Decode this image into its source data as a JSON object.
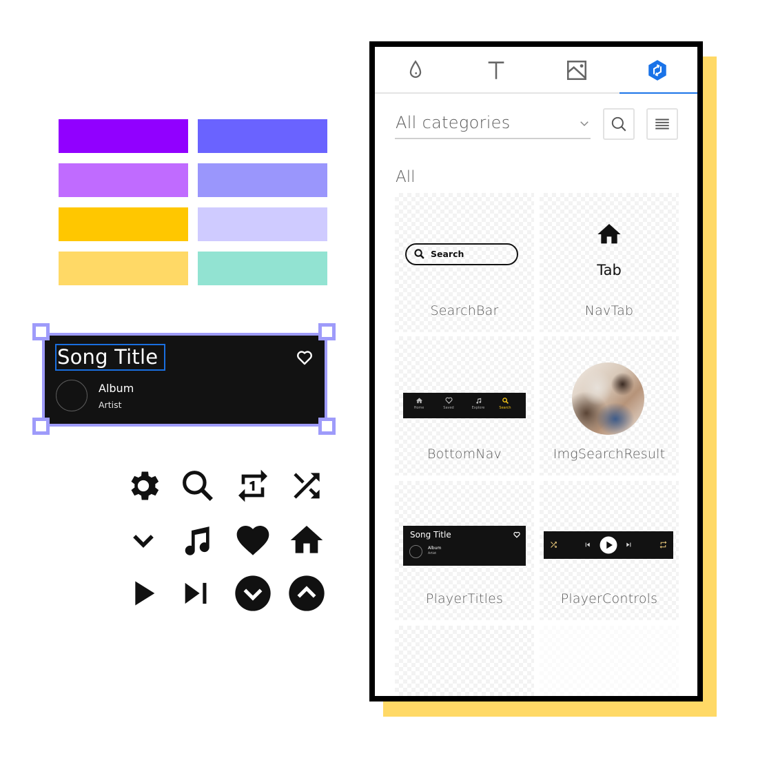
{
  "palette": {
    "swatches": [
      {
        "name": "purple",
        "color": "#9100ff"
      },
      {
        "name": "indigo",
        "color": "#6a63ff"
      },
      {
        "name": "light-purple",
        "color": "#c06bff"
      },
      {
        "name": "light-indigo",
        "color": "#9a96fc"
      },
      {
        "name": "amber",
        "color": "#ffc700"
      },
      {
        "name": "lavender",
        "color": "#cfcbff"
      },
      {
        "name": "light-amber",
        "color": "#ffd966"
      },
      {
        "name": "mint",
        "color": "#92e3d2"
      }
    ]
  },
  "selected_component": {
    "song_title": "Song Title",
    "album": "Album",
    "artist": "Artist",
    "selection_color": "#9e9bfa",
    "text_box_color": "#1a6fe0"
  },
  "icon_set": [
    "settings-icon",
    "search-icon",
    "repeat-one-icon",
    "shuffle-icon",
    "chevron-down-icon",
    "music-note-icon",
    "heart-icon",
    "home-icon",
    "play-icon",
    "skip-next-icon",
    "expand-circle-down-icon",
    "expand-circle-up-icon"
  ],
  "panel": {
    "tabs": [
      {
        "name": "style",
        "icon": "drop-icon",
        "active": false
      },
      {
        "name": "text",
        "icon": "text-icon",
        "active": false
      },
      {
        "name": "images",
        "icon": "image-icon",
        "active": false
      },
      {
        "name": "components",
        "icon": "components-icon",
        "active": true
      }
    ],
    "accent_color": "#1a73e8",
    "category_select": {
      "value": "All categories"
    },
    "section_title": "All",
    "components": [
      {
        "label": "SearchBar",
        "preview_text": "Search"
      },
      {
        "label": "NavTab",
        "preview_text": "Tab"
      },
      {
        "label": "BottomNav",
        "items": [
          "Home",
          "Saved",
          "Explore",
          "Search"
        ],
        "active_item": "Search"
      },
      {
        "label": "ImgSearchResult"
      },
      {
        "label": "PlayerTitles",
        "title": "Song Title",
        "album": "Album",
        "artist": "Artist"
      },
      {
        "label": "PlayerControls"
      }
    ]
  }
}
